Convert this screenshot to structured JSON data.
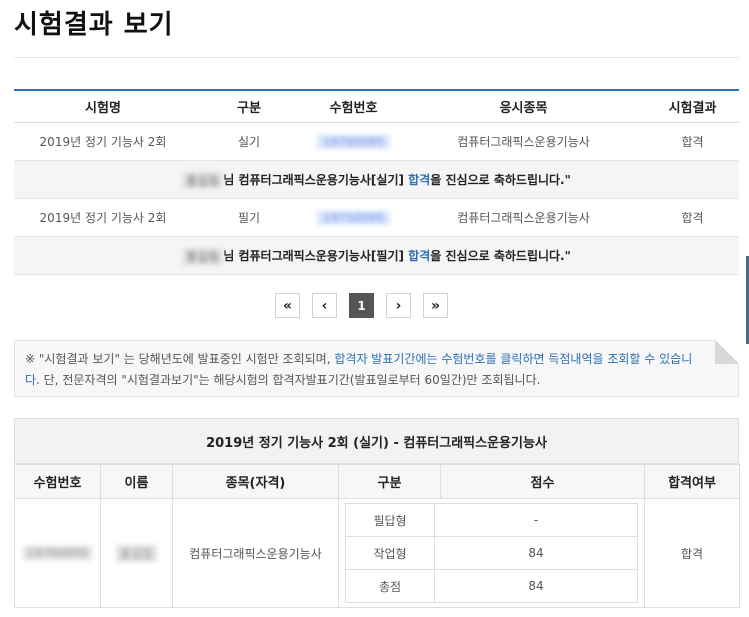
{
  "page": {
    "title": "시험결과 보기"
  },
  "results": {
    "headers": [
      "시험명",
      "구분",
      "수험번호",
      "응시종목",
      "시험결과"
    ],
    "rows": [
      {
        "exam_name": "2019년 정기 기능사 2회",
        "type": "실기",
        "exam_number": "19760095",
        "subject": "컴퓨터그래픽스운용기능사",
        "result": "합격",
        "msg_name": "홍길동",
        "msg_before": "님 컴퓨터그래픽스운용기능사[실기] ",
        "msg_pass": "합격",
        "msg_after": "을 진심으로 축하드립니다.\""
      },
      {
        "exam_name": "2019년 정기 기능사 2회",
        "type": "필기",
        "exam_number": "19750095",
        "subject": "컴퓨터그래픽스운용기능사",
        "result": "합격",
        "msg_name": "홍길동",
        "msg_before": "님 컴퓨터그래픽스운용기능사[필기] ",
        "msg_pass": "합격",
        "msg_after": "을 진심으로 축하드립니다.\""
      }
    ]
  },
  "pagination": {
    "first": "«",
    "prev": "‹",
    "current": "1",
    "next": "›",
    "last": "»"
  },
  "notice": {
    "part1": "※ \"시험결과 보기\" 는 당해년도에 발표중인 시험만 조회되며, ",
    "highlight": "합격자 발표기간에는 수험번호를 클릭하면 득점내역을 조회할 수 있습니다.",
    "part2": " 단, 전문자격의 \"시험결과보기\"는 해당시험의 합격자발표기간(발표일로부터 60일간)만 조회됩니다."
  },
  "detail": {
    "title": "2019년 정기 기능사 2회 (실기) - 컴퓨터그래픽스운용기능사",
    "headers": [
      "수험번호",
      "이름",
      "종목(자격)",
      "구분",
      "점수",
      "합격여부"
    ],
    "exam_number": "19760095",
    "name": "홍길동",
    "subject": "컴퓨터그래픽스운용기능사",
    "scores": [
      {
        "label": "필답형",
        "value": "-"
      },
      {
        "label": "작업형",
        "value": "84"
      },
      {
        "label": "총점",
        "value": "84"
      }
    ],
    "result": "합격"
  },
  "colors": {
    "accent": "#2e6fb6"
  }
}
